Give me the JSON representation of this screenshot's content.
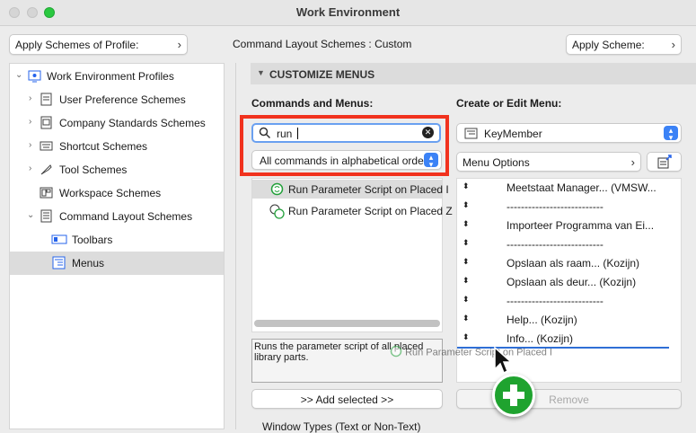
{
  "window": {
    "title": "Work Environment"
  },
  "header": {
    "apply_profile_label": "Apply Schemes of Profile:",
    "layout_scheme_label": "Command Layout Schemes : ",
    "layout_scheme_value": "Custom",
    "apply_scheme_label": "Apply Scheme:"
  },
  "tree": {
    "root": "Work Environment Profiles",
    "items": [
      "User Preference Schemes",
      "Company Standards Schemes",
      "Shortcut Schemes",
      "Tool Schemes",
      "Workspace Schemes",
      "Command Layout Schemes"
    ],
    "children": [
      "Toolbars",
      "Menus"
    ]
  },
  "section": {
    "title": "CUSTOMIZE MENUS"
  },
  "commands": {
    "heading": "Commands and Menus:",
    "search_value": "run",
    "filter_value": "All commands in alphabetical order",
    "results": [
      "Run Parameter Script on Placed I",
      "Run Parameter Script on Placed Z"
    ],
    "description": "Runs the parameter script of all placed library parts.",
    "add_button": ">> Add selected >>",
    "window_types": "Window Types (Text or Non-Text)"
  },
  "menu": {
    "heading": "Create or Edit Menu:",
    "selected_menu": "KeyMember",
    "options_label": "Menu Options",
    "items": [
      "Meetstaat Manager... (VMSW...",
      "---------------------------",
      "Importeer Programma van Ei...",
      "---------------------------",
      "Opslaan als raam... (Kozijn)",
      "Opslaan als deur... (Kozijn)",
      "---------------------------",
      "Help... (Kozijn)",
      "Info... (Kozijn)"
    ],
    "drag_ghost": "Run Parameter Script on Placed I",
    "remove_button": "Remove"
  },
  "colors": {
    "accent": "#3b82f6",
    "highlight": "#f1321e",
    "add_green": "#1fa32f"
  }
}
